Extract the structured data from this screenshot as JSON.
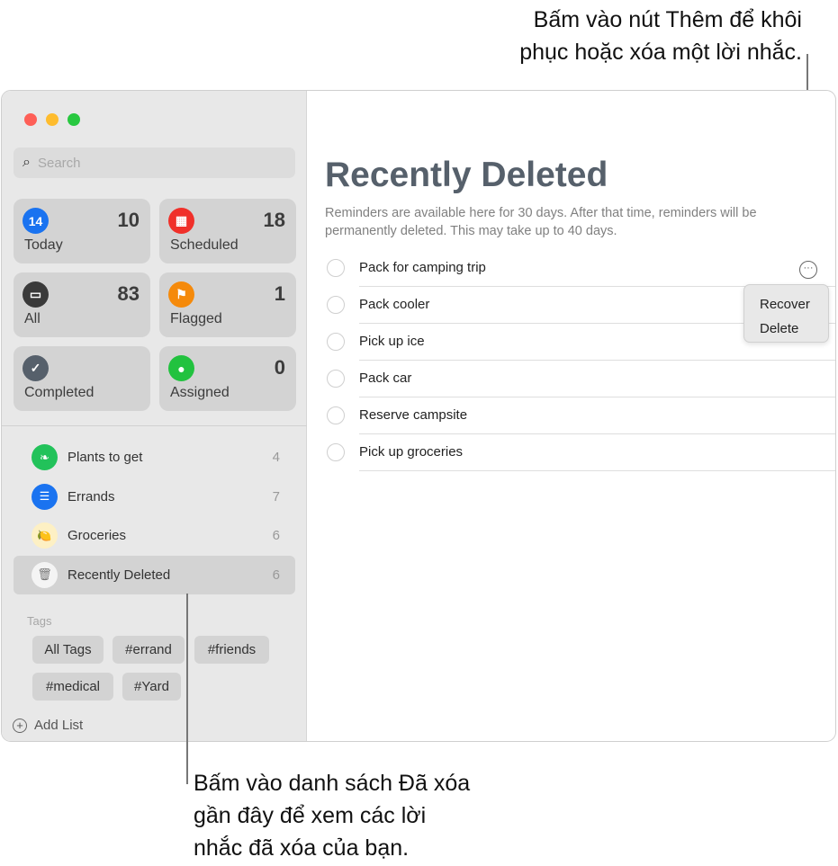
{
  "callouts": {
    "top": [
      "Bấm vào nút Thêm để khôi",
      "phục hoặc xóa một lời nhắc."
    ],
    "bottom": [
      "Bấm vào danh sách Đã xóa",
      "gần đây để xem các lời",
      "nhắc đã xóa của bạn."
    ]
  },
  "sidebar": {
    "search_placeholder": "Search",
    "smart_lists": [
      {
        "label": "Today",
        "count": "10",
        "color": "#1a73f0",
        "icon": "calendar-today-icon",
        "glyph": "14"
      },
      {
        "label": "Scheduled",
        "count": "18",
        "color": "#f0302a",
        "icon": "calendar-icon",
        "glyph": "▦"
      },
      {
        "label": "All",
        "count": "83",
        "color": "#3a3a3a",
        "icon": "tray-icon",
        "glyph": "▭"
      },
      {
        "label": "Flagged",
        "count": "1",
        "color": "#f58a0b",
        "icon": "flag-icon",
        "glyph": "⚑"
      },
      {
        "label": "Completed",
        "count": "",
        "color": "#56606b",
        "icon": "checkmark-icon",
        "glyph": "✓"
      },
      {
        "label": "Assigned",
        "count": "0",
        "color": "#22c23f",
        "icon": "person-icon",
        "glyph": "●"
      }
    ],
    "lists": [
      {
        "label": "Plants to get",
        "count": "4",
        "color": "#22c25a",
        "icon": "leaf-icon",
        "glyph": "❧"
      },
      {
        "label": "Errands",
        "count": "7",
        "color": "#1a73f0",
        "icon": "list-icon",
        "glyph": "☰"
      },
      {
        "label": "Groceries",
        "count": "6",
        "color": "#fdf0c4",
        "icon": "lemon-icon",
        "glyph": "🍋"
      },
      {
        "label": "Recently Deleted",
        "count": "6",
        "color": "#f4f4f4",
        "icon": "trash-icon",
        "glyph": "🗑"
      }
    ],
    "tags_header": "Tags",
    "tags": [
      "All Tags",
      "#errand",
      "#friends",
      "#medical",
      "#Yard"
    ],
    "add_list": "Add List"
  },
  "main": {
    "title": "Recently Deleted",
    "description": "Reminders are available here for 30 days. After that time, reminders will be permanently deleted. This may take up to 40 days.",
    "reminders": [
      "Pack for camping trip",
      "Pack cooler",
      "Pick up ice",
      "Pack car",
      "Reserve campsite",
      "Pick up groceries"
    ],
    "menu": [
      "Recover",
      "Delete"
    ]
  }
}
